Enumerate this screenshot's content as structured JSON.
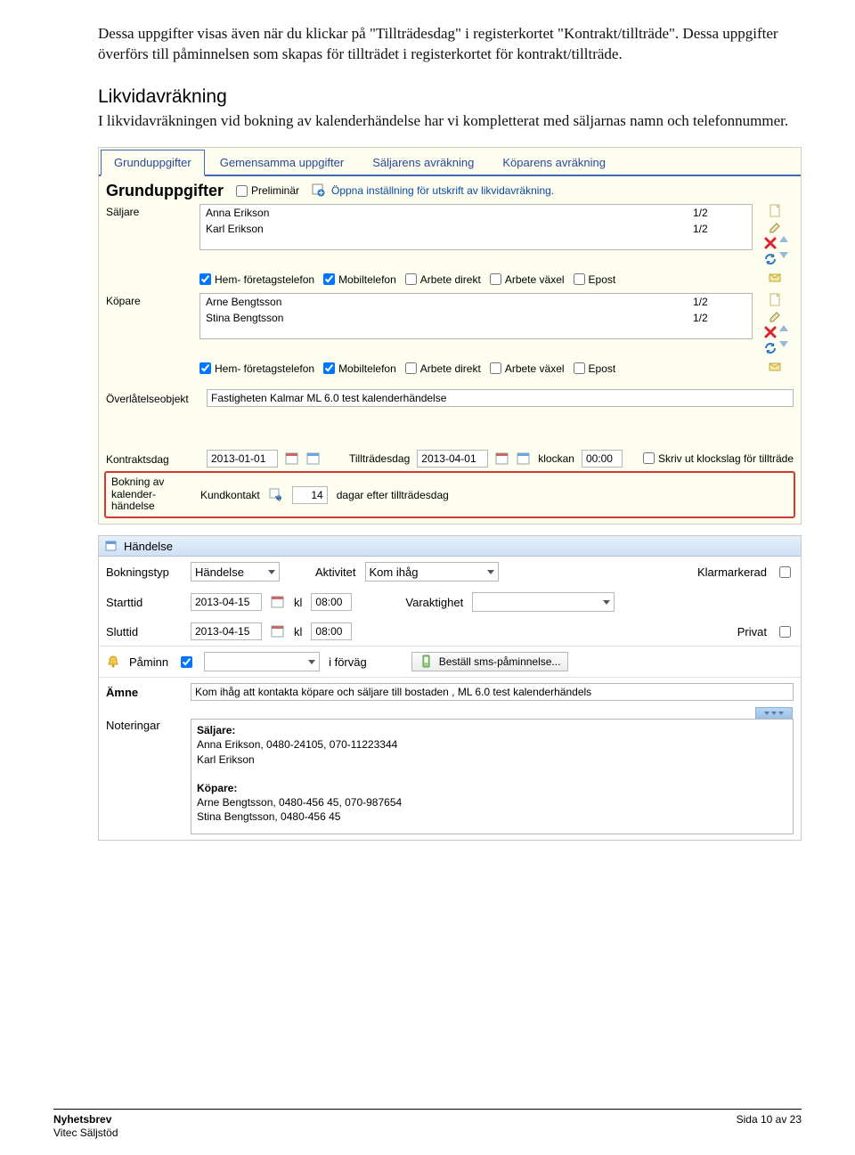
{
  "doc": {
    "para1": "Dessa uppgifter visas även när du klickar på \"Tillträdesdag\" i registerkortet \"Kontrakt/tillträde\". Dessa uppgifter överförs till påminnelsen som skapas för tillträdet i registerkortet för kontrakt/tillträde.",
    "h2": "Likvidavräkning",
    "para2": "I likvidavräkningen vid bokning av kalenderhändelse har vi kompletterat med säljarnas namn och telefonnummer."
  },
  "panel1": {
    "tabs": [
      "Grunduppgifter",
      "Gemensamma uppgifter",
      "Säljarens avräkning",
      "Köparens avräkning"
    ],
    "title": "Grunduppgifter",
    "preliminar": "Preliminär",
    "open_settings": "Öppna inställning för utskrift av likvidavräkning.",
    "seller_label": "Säljare",
    "buyers_label": "Köpare",
    "sellers": [
      {
        "name": "Anna Erikson",
        "share": "1/2"
      },
      {
        "name": "Karl Erikson",
        "share": "1/2"
      }
    ],
    "buyers": [
      {
        "name": "Arne Bengtsson",
        "share": "1/2"
      },
      {
        "name": "Stina Bengtsson",
        "share": "1/2"
      }
    ],
    "phones": {
      "hem": "Hem- företagstelefon",
      "mobil": "Mobiltelefon",
      "arb_direkt": "Arbete direkt",
      "arb_vaxel": "Arbete växel",
      "epost": "Epost"
    },
    "obj_label": "Överlåtelseobjekt",
    "obj_value": "Fastigheten Kalmar ML 6.0 test kalenderhändelse",
    "kontraktsdag_label": "Kontraktsdag",
    "kontraktsdag": "2013-01-01",
    "tilltradesdag_label": "Tillträdesdag",
    "tilltradesdag": "2013-04-01",
    "klockan_label": "klockan",
    "klockan": "00:00",
    "skriv_ut": "Skriv ut klockslag för tillträde",
    "bokning_label": "Bokning av kalender-händelse",
    "kundkontakt_label": "Kundkontakt",
    "dagar": "14",
    "dagar_efter": "dagar efter tillträdesdag"
  },
  "panel2": {
    "title": "Händelse",
    "bokningstyp_label": "Bokningstyp",
    "bokningstyp": "Händelse",
    "aktivitet_label": "Aktivitet",
    "aktivitet": "Kom ihåg",
    "klarmarkerad": "Klarmarkerad",
    "starttid_label": "Starttid",
    "starttid": "2013-04-15",
    "kl_label": "kl",
    "starttid_kl": "08:00",
    "varaktighet_label": "Varaktighet",
    "sluttid_label": "Sluttid",
    "sluttid": "2013-04-15",
    "sluttid_kl": "08:00",
    "privat_label": "Privat",
    "paminn_label": "Påminn",
    "i_forvag": "i förväg",
    "sms_button": "Beställ sms-påminnelse...",
    "amne_label": "Ämne",
    "amne_value": "Kom ihåg att kontakta köpare och säljare till bostaden , ML 6.0 test kalenderhändels",
    "noteringar_label": "Noteringar",
    "notes": {
      "seller_head": "Säljare:",
      "s1": "Anna Erikson, 0480-24105, 070-11223344",
      "s2": "Karl Erikson",
      "buyer_head": "Köpare:",
      "b1": "Arne Bengtsson, 0480-456 45, 070-987654",
      "b2": "Stina Bengtsson, 0480-456 45"
    }
  },
  "footer": {
    "l1": "Nyhetsbrev",
    "l2": "Vitec Säljstöd",
    "r": "Sida 10 av 23"
  }
}
